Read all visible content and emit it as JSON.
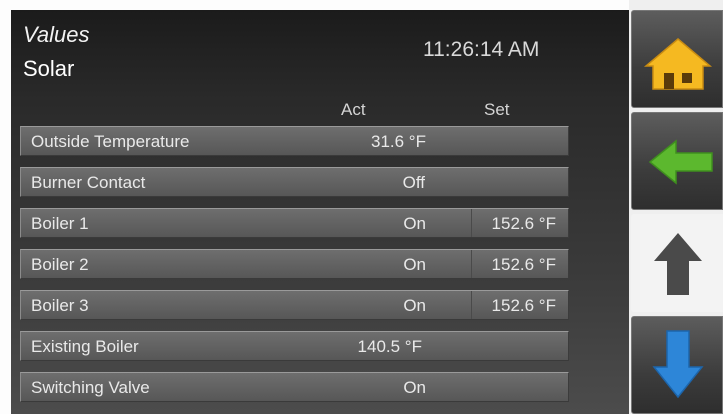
{
  "header": {
    "section": "Values",
    "subtitle": "Solar",
    "time": "11:26:14 AM"
  },
  "columns": {
    "act": "Act",
    "set": "Set"
  },
  "rows": [
    {
      "label": "Outside Temperature",
      "act": "31.6 °F",
      "set": ""
    },
    {
      "label": "Burner Contact",
      "act": "Off",
      "set": ""
    },
    {
      "label": "Boiler 1",
      "act": "On",
      "set": "152.6 °F"
    },
    {
      "label": "Boiler 2",
      "act": "On",
      "set": "152.6 °F"
    },
    {
      "label": "Boiler 3",
      "act": "On",
      "set": "152.6 °F"
    },
    {
      "label": "Existing Boiler",
      "act": "140.5 °F",
      "set": ""
    },
    {
      "label": "Switching Valve",
      "act": "On",
      "set": ""
    }
  ],
  "nav": {
    "home_icon": "home-icon",
    "back_icon": "arrow-left-icon",
    "up_icon": "arrow-up-icon",
    "down_icon": "arrow-down-icon",
    "colors": {
      "home": "#f5b921",
      "back": "#5cb82e",
      "up_disabled": "#4a4a4a",
      "down": "#2d86d8"
    }
  }
}
